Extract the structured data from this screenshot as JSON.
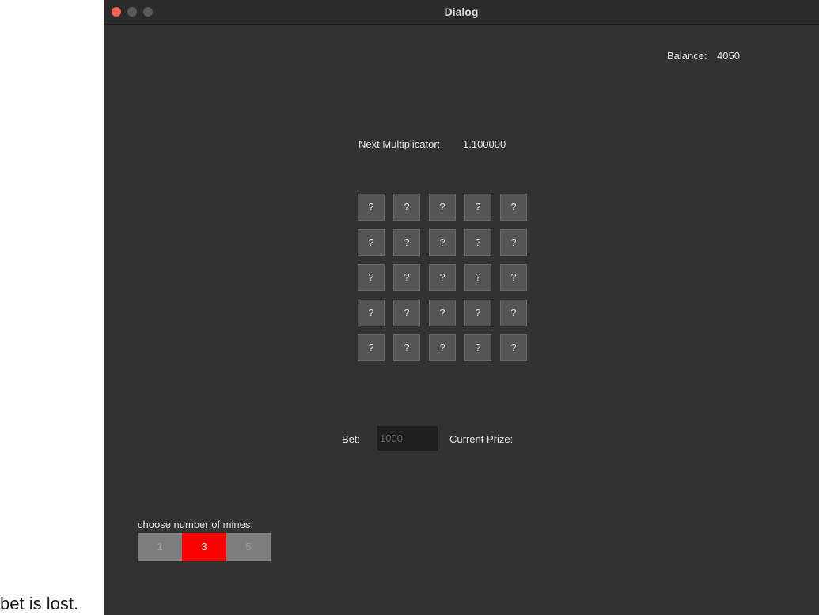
{
  "document": {
    "trailing_text": "bet is lost."
  },
  "window": {
    "title": "Dialog"
  },
  "balance": {
    "label": "Balance:",
    "value": "4050"
  },
  "multiplicator": {
    "label": "Next Multiplicator:",
    "value": "1.100000"
  },
  "grid": {
    "rows": [
      [
        "?",
        "?",
        "?",
        "?",
        "?"
      ],
      [
        "?",
        "?",
        "?",
        "?",
        "?"
      ],
      [
        "?",
        "?",
        "?",
        "?",
        "?"
      ],
      [
        "?",
        "?",
        "?",
        "?",
        "?"
      ],
      [
        "?",
        "?",
        "?",
        "?",
        "?"
      ]
    ]
  },
  "bet": {
    "label": "Bet:",
    "placeholder": "1000"
  },
  "prize": {
    "label": "Current Prize:"
  },
  "mines": {
    "label": "choose number of mines:",
    "options": [
      "1",
      "3",
      "5"
    ],
    "selected": "3",
    "selected_color": "#fb0000"
  }
}
